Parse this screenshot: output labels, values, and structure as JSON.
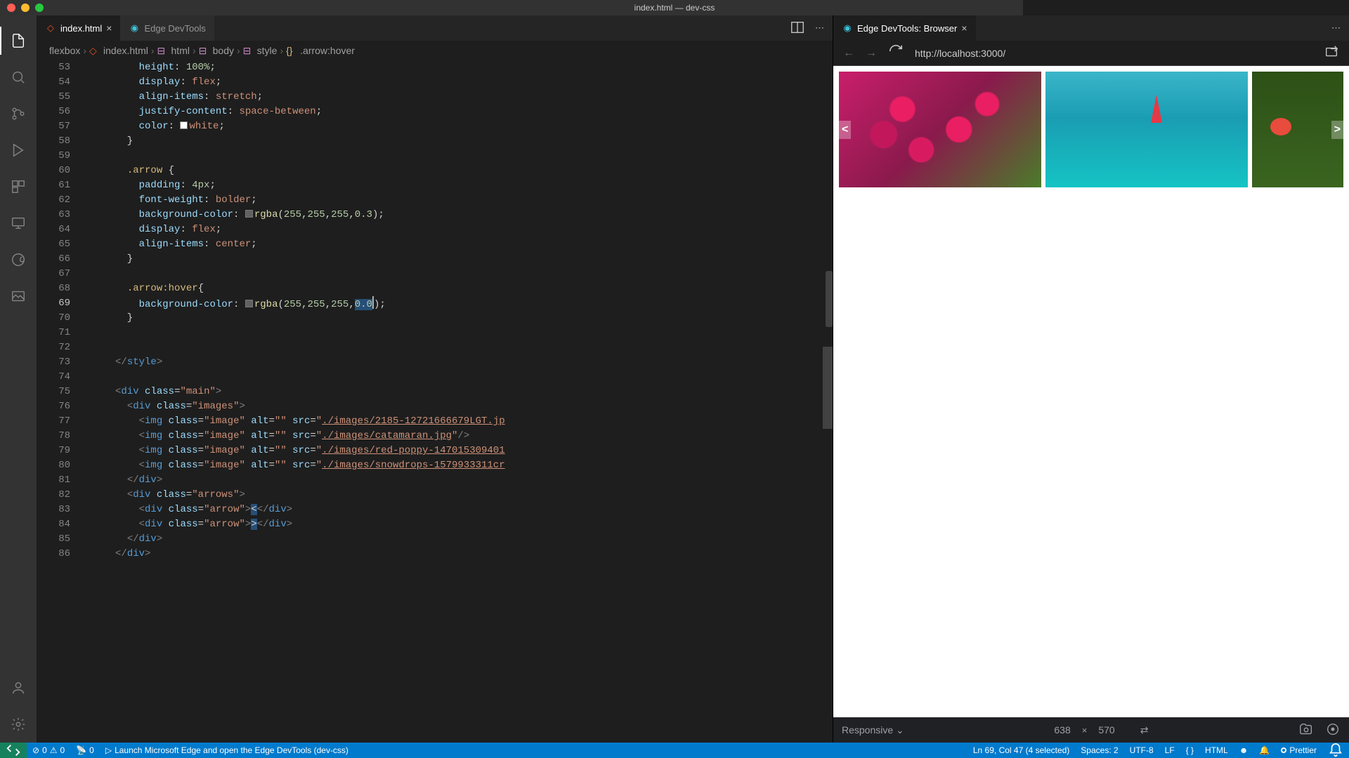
{
  "window": {
    "title": "index.html — dev-css"
  },
  "tabs": {
    "editor1": {
      "label": "index.html",
      "icon": "html"
    },
    "editor2": {
      "label": "Edge DevTools",
      "icon": "edge"
    },
    "browser": {
      "label": "Edge DevTools: Browser",
      "icon": "edge"
    }
  },
  "breadcrumbs": {
    "items": [
      "flexbox",
      "index.html",
      "html",
      "body",
      "style",
      ".arrow:hover"
    ]
  },
  "editor": {
    "first_line": 53,
    "active_line": 69
  },
  "code_lines": [
    {
      "n": 53,
      "html": "         <span class='tok-prop'>height</span>: <span class='tok-num'>100%</span>;"
    },
    {
      "n": 54,
      "html": "         <span class='tok-prop'>display</span>: <span class='tok-val'>flex</span>;"
    },
    {
      "n": 55,
      "html": "         <span class='tok-prop'>align-items</span>: <span class='tok-val'>stretch</span>;"
    },
    {
      "n": 56,
      "html": "         <span class='tok-prop'>justify-content</span>: <span class='tok-val'>space-between</span>;"
    },
    {
      "n": 57,
      "html": "         <span class='tok-prop'>color</span>: <span class='color-swatch sw-white'></span><span class='tok-val'>white</span>;"
    },
    {
      "n": 58,
      "html": "       }"
    },
    {
      "n": 59,
      "html": ""
    },
    {
      "n": 60,
      "html": "       <span class='tok-sel'>.arrow</span> {"
    },
    {
      "n": 61,
      "html": "         <span class='tok-prop'>padding</span>: <span class='tok-num'>4px</span>;"
    },
    {
      "n": 62,
      "html": "         <span class='tok-prop'>font-weight</span>: <span class='tok-val'>bolder</span>;"
    },
    {
      "n": 63,
      "html": "         <span class='tok-prop'>background-color</span>: <span class='color-swatch sw-trans'></span><span class='tok-fn'>rgba</span>(<span class='tok-num'>255</span>,<span class='tok-num'>255</span>,<span class='tok-num'>255</span>,<span class='tok-num'>0.3</span>);"
    },
    {
      "n": 64,
      "html": "         <span class='tok-prop'>display</span>: <span class='tok-val'>flex</span>;"
    },
    {
      "n": 65,
      "html": "         <span class='tok-prop'>align-items</span>: <span class='tok-val'>center</span>;"
    },
    {
      "n": 66,
      "html": "       }"
    },
    {
      "n": 67,
      "html": ""
    },
    {
      "n": 68,
      "html": "       <span class='tok-sel'>.arrow:hover</span>{"
    },
    {
      "n": 69,
      "html": "         <span class='tok-prop'>background-color</span>: <span class='color-swatch sw-trans'></span><span class='tok-fn'>rgba</span>(<span class='tok-num'>255</span>,<span class='tok-num'>255</span>,<span class='tok-num'>255</span>,<span class='tok-num selection'>0.0</span><span class='cursor-mark'></span>);"
    },
    {
      "n": 70,
      "html": "       }"
    },
    {
      "n": 71,
      "html": ""
    },
    {
      "n": 72,
      "html": ""
    },
    {
      "n": 73,
      "html": "     <span class='tok-punc'>&lt;/</span><span class='tok-tag'>style</span><span class='tok-punc'>&gt;</span>"
    },
    {
      "n": 74,
      "html": ""
    },
    {
      "n": 75,
      "html": "     <span class='tok-punc'>&lt;</span><span class='tok-tag'>div</span> <span class='tok-attr'>class</span>=<span class='tok-val'>\"main\"</span><span class='tok-punc'>&gt;</span>"
    },
    {
      "n": 76,
      "html": "       <span class='tok-punc'>&lt;</span><span class='tok-tag'>div</span> <span class='tok-attr'>class</span>=<span class='tok-val'>\"images\"</span><span class='tok-punc'>&gt;</span>"
    },
    {
      "n": 77,
      "html": "         <span class='tok-punc'>&lt;</span><span class='tok-tag'>img</span> <span class='tok-attr'>class</span>=<span class='tok-val'>\"image\"</span> <span class='tok-attr'>alt</span>=<span class='tok-val'>\"\"</span> <span class='tok-attr'>src</span>=<span class='tok-val'>\"<u>./images/2185-12721666679LGT.jp</u></span>"
    },
    {
      "n": 78,
      "html": "         <span class='tok-punc'>&lt;</span><span class='tok-tag'>img</span> <span class='tok-attr'>class</span>=<span class='tok-val'>\"image\"</span> <span class='tok-attr'>alt</span>=<span class='tok-val'>\"\"</span> <span class='tok-attr'>src</span>=<span class='tok-val'>\"<u>./images/catamaran.jpg</u>\"</span><span class='tok-punc'>/&gt;</span>"
    },
    {
      "n": 79,
      "html": "         <span class='tok-punc'>&lt;</span><span class='tok-tag'>img</span> <span class='tok-attr'>class</span>=<span class='tok-val'>\"image\"</span> <span class='tok-attr'>alt</span>=<span class='tok-val'>\"\"</span> <span class='tok-attr'>src</span>=<span class='tok-val'>\"<u>./images/red-poppy-147015309401</u></span>"
    },
    {
      "n": 80,
      "html": "         <span class='tok-punc'>&lt;</span><span class='tok-tag'>img</span> <span class='tok-attr'>class</span>=<span class='tok-val'>\"image\"</span> <span class='tok-attr'>alt</span>=<span class='tok-val'>\"\"</span> <span class='tok-attr'>src</span>=<span class='tok-val'>\"<u>./images/snowdrops-1579933311cr</u></span>"
    },
    {
      "n": 81,
      "html": "       <span class='tok-punc'>&lt;/</span><span class='tok-tag'>div</span><span class='tok-punc'>&gt;</span>"
    },
    {
      "n": 82,
      "html": "       <span class='tok-punc'>&lt;</span><span class='tok-tag'>div</span> <span class='tok-attr'>class</span>=<span class='tok-val'>\"arrows\"</span><span class='tok-punc'>&gt;</span>"
    },
    {
      "n": 83,
      "html": "         <span class='tok-punc'>&lt;</span><span class='tok-tag'>div</span> <span class='tok-attr'>class</span>=<span class='tok-val'>\"arrow\"</span><span class='tok-punc'>&gt;</span><span class='selection'>&lt;</span><span class='tok-punc'>&lt;/</span><span class='tok-tag'>div</span><span class='tok-punc'>&gt;</span>"
    },
    {
      "n": 84,
      "html": "         <span class='tok-punc'>&lt;</span><span class='tok-tag'>div</span> <span class='tok-attr'>class</span>=<span class='tok-val'>\"arrow\"</span><span class='tok-punc'>&gt;</span><span class='selection'>&gt;</span><span class='tok-punc'>&lt;/</span><span class='tok-tag'>div</span><span class='tok-punc'>&gt;</span>"
    },
    {
      "n": 85,
      "html": "       <span class='tok-punc'>&lt;/</span><span class='tok-tag'>div</span><span class='tok-punc'>&gt;</span>"
    },
    {
      "n": 86,
      "html": "     <span class='tok-punc'>&lt;/</span><span class='tok-tag'>div</span><span class='tok-punc'>&gt;</span>"
    }
  ],
  "browser": {
    "url": "http://localhost:3000/",
    "arrow_left": "<",
    "arrow_right": ">"
  },
  "devtools": {
    "device": "Responsive",
    "width": "638",
    "height": "570",
    "sep": "×"
  },
  "statusbar": {
    "errors": "0",
    "warnings": "0",
    "ports": "0",
    "launch": "Launch Microsoft Edge and open the Edge DevTools (dev-css)",
    "cursor": "Ln 69, Col 47 (4 selected)",
    "spaces": "Spaces: 2",
    "encoding": "UTF-8",
    "eol": "LF",
    "lang": "HTML",
    "prettier": "Prettier"
  }
}
